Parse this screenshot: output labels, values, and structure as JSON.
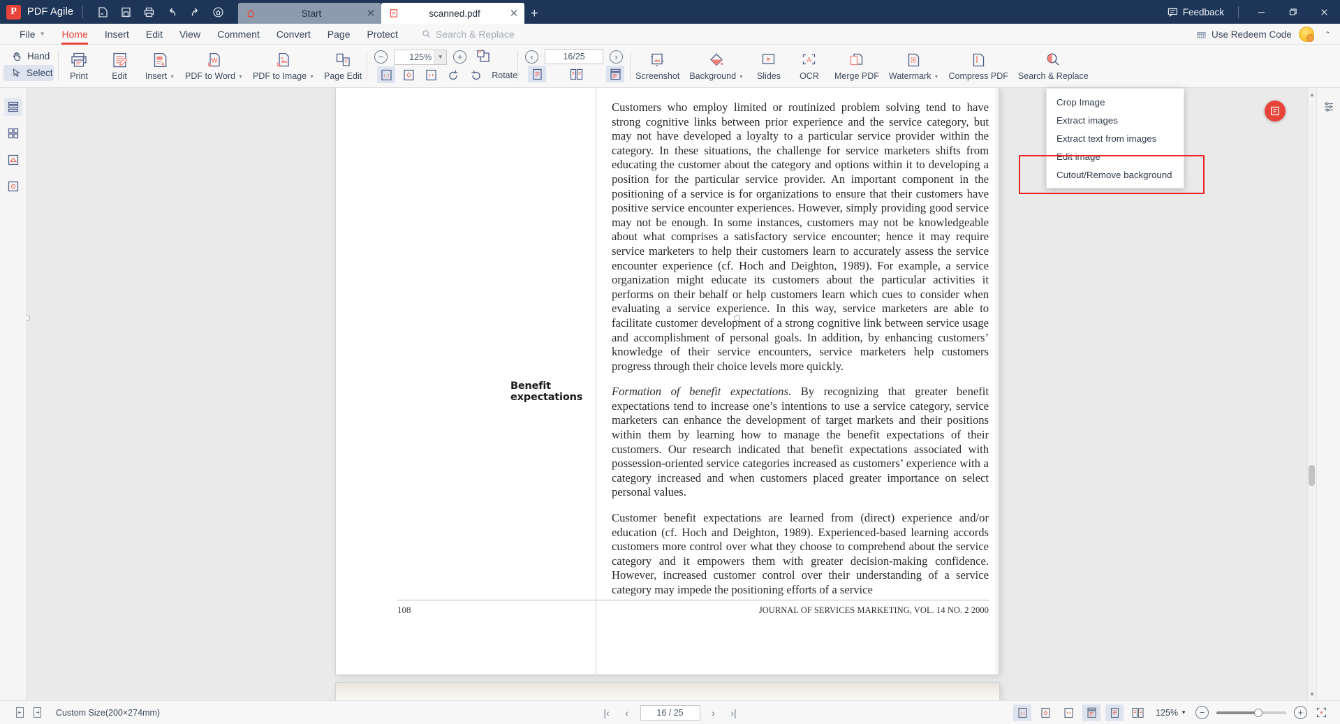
{
  "window": {
    "app_name": "PDF Agile",
    "logo_letter": "P",
    "feedback_label": "Feedback",
    "title_icons": [
      "new-file-icon",
      "save-icon",
      "print-icon",
      "undo-icon",
      "redo-icon",
      "home-circle-icon"
    ],
    "minimize": "—",
    "maximize": "❐",
    "close": "✕"
  },
  "tabs": [
    {
      "label": "Start",
      "icon": "home-icon",
      "active": false,
      "close": "✕"
    },
    {
      "label": "scanned.pdf",
      "icon": "pdf-icon",
      "active": true,
      "close": "✕"
    }
  ],
  "new_tab_label": "+",
  "menubar": {
    "items": [
      {
        "label": "File",
        "caret": true,
        "active": false
      },
      {
        "label": "Home",
        "caret": false,
        "active": true
      },
      {
        "label": "Insert",
        "caret": false,
        "active": false
      },
      {
        "label": "Edit",
        "caret": false,
        "active": false
      },
      {
        "label": "View",
        "caret": false,
        "active": false
      },
      {
        "label": "Comment",
        "caret": false,
        "active": false
      },
      {
        "label": "Convert",
        "caret": false,
        "active": false
      },
      {
        "label": "Page",
        "caret": false,
        "active": false
      },
      {
        "label": "Protect",
        "caret": false,
        "active": false
      }
    ],
    "search_placeholder": "Search & Replace",
    "redeem_label": "Use Redeem Code"
  },
  "ribbon": {
    "modes": [
      {
        "label": "Hand",
        "icon": "hand-icon",
        "selected": false
      },
      {
        "label": "Select",
        "icon": "cursor-icon",
        "selected": true
      }
    ],
    "group1": [
      {
        "label": "Print",
        "icon": "print-icon",
        "caret": false
      },
      {
        "label": "Edit",
        "icon": "edit-doc-icon",
        "caret": false
      },
      {
        "label": "Insert",
        "icon": "insert-doc-icon",
        "caret": true
      },
      {
        "label": "PDF to Word",
        "icon": "pdf-to-word-icon",
        "caret": true
      },
      {
        "label": "PDF to Image",
        "icon": "pdf-to-image-icon",
        "caret": true
      },
      {
        "label": "Page Edit",
        "icon": "page-edit-icon",
        "caret": false
      }
    ],
    "zoom": {
      "minus": "−",
      "plus": "+",
      "value": "125%",
      "rotate_label": "Rotate",
      "fit_buttons": [
        "actual-size-icon",
        "fit-page-icon",
        "fit-width-icon",
        "rotate-left-icon",
        "rotate-right-icon"
      ]
    },
    "pagenav": {
      "prev": "‹",
      "next": "›",
      "value": "16/25",
      "view_buttons": [
        "single-page-icon",
        "two-page-icon",
        "continuous-scroll-icon"
      ]
    },
    "group2": [
      {
        "label": "Screenshot",
        "icon": "screenshot-icon",
        "caret": false
      },
      {
        "label": "Background",
        "icon": "background-icon",
        "caret": true
      },
      {
        "label": "Slides",
        "icon": "slides-icon",
        "caret": false
      },
      {
        "label": "OCR",
        "icon": "ocr-icon",
        "caret": false
      },
      {
        "label": "Merge PDF",
        "icon": "merge-pdf-icon",
        "caret": false
      },
      {
        "label": "Watermark",
        "icon": "watermark-icon",
        "caret": true
      },
      {
        "label": "Compress PDF",
        "icon": "compress-pdf-icon",
        "caret": false
      },
      {
        "label": "Search & Replace",
        "icon": "search-replace-icon",
        "caret": false
      }
    ]
  },
  "dropdown": {
    "items": [
      "Crop Image",
      "Extract images",
      "Extract text from images",
      "Edit image",
      "Cutout/Remove background"
    ],
    "highlight_color": "#ee2222"
  },
  "document": {
    "side_heading": "Benefit expectations",
    "paragraphs": [
      "Customers who employ limited or routinized problem solving tend to have strong cognitive links between prior experience and the service category, but may not have developed a loyalty to a particular service provider within the category. In these situations, the challenge for service marketers shifts from educating the customer about the category and options within it to developing a position for the particular service provider. An important component in the positioning of a service is for organizations to ensure that their customers have positive service encounter experiences. However, simply providing good service may not be enough. In some instances, customers may not be knowledgeable about what comprises a satisfactory service encounter; hence it may require service marketers to help their customers learn to accurately assess the service encounter experience (cf. Hoch and Deighton, 1989). For example, a service organization might educate its customers about the particular activities it performs on their behalf or help customers learn which cues to consider when evaluating a service experience. In this way, service marketers are able to facilitate customer development of a strong cognitive link between service usage and accomplishment of personal goals. In addition, by enhancing customers’ knowledge of their service encounters, service marketers help customers progress through their choice levels more quickly.",
      "Formation of benefit expectations. By recognizing that greater benefit expectations tend to increase one’s intentions to use a service category, service marketers can enhance the development of target markets and their positions within them by learning how to manage the benefit expectations of their customers. Our research indicated that benefit expectations associated with possession-oriented service categories increased as customers’ experience with a category increased and when customers placed greater importance on select personal values.",
      "Customer benefit expectations are learned from (direct) experience and/or education (cf. Hoch and Deighton, 1989). Experienced-based learning accords customers more control over what they choose to comprehend about the service category and it empowers them with greater decision-making confidence. However, increased customer control over their understanding of a service category may impede the positioning efforts of a service"
    ],
    "italic_lead": "Formation of benefit expectations",
    "folio": "108",
    "journal_line": "JOURNAL OF SERVICES MARKETING, VOL. 14 NO. 2 2000"
  },
  "statusbar": {
    "page_size": "Custom Size(200×274mm)",
    "first_page": "|‹",
    "prev_page": "‹",
    "page_value": "16 / 25",
    "next_page": "›",
    "last_page": "›|",
    "zoom_level": "125%",
    "zoom_out": "−",
    "zoom_in": "+",
    "view_icons": [
      "actual-size-icon",
      "fit-page-icon",
      "fit-width-icon",
      "continuous-icon",
      "single-page-icon",
      "two-page-icon"
    ],
    "fullscreen_icon": "fullscreen-icon"
  }
}
